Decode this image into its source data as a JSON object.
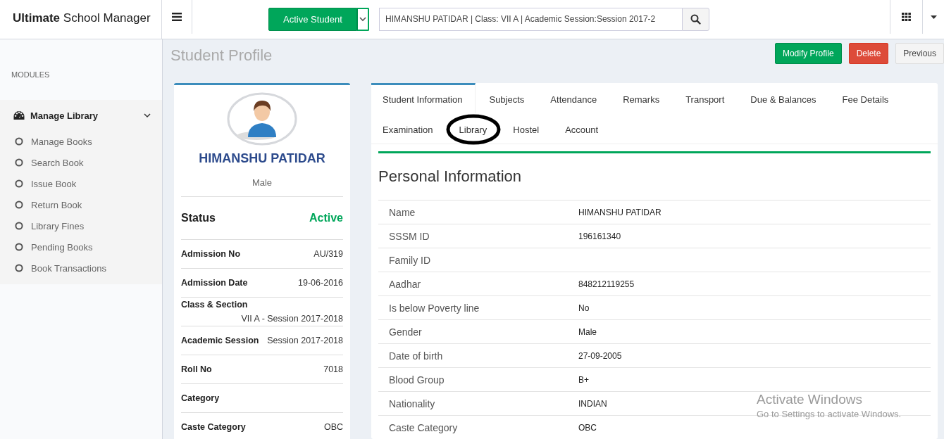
{
  "header": {
    "brand": "**Ultimate** School Manager",
    "filter_button": "Active Student",
    "search": {
      "value": "HIMANSHU PATIDAR | Class: VII A | Academic Session:Session 2017-2"
    }
  },
  "sidebar": {
    "section_label": "MODULES",
    "groups": [
      {
        "label": "Manage Library",
        "expanded": true,
        "children": [
          {
            "label": "Manage Books"
          },
          {
            "label": "Search Book"
          },
          {
            "label": "Issue Book"
          },
          {
            "label": "Return Book"
          },
          {
            "label": "Library Fines"
          },
          {
            "label": "Pending Books"
          },
          {
            "label": "Book Transactions"
          }
        ]
      }
    ]
  },
  "page_title": "Student Profile",
  "actions": [
    {
      "label": "Modify Profile",
      "kind": "success"
    },
    {
      "label": "Delete",
      "kind": "danger"
    },
    {
      "label": "Previous",
      "kind": "default"
    }
  ],
  "profile": {
    "name": "HIMANSHU PATIDAR",
    "gender": "Male",
    "status_label": "Status",
    "status_value": "Active",
    "fields": [
      {
        "label": "Admission No",
        "value": "AU/319"
      },
      {
        "label": "Admission Date",
        "value": "19-06-2016"
      },
      {
        "label": "Class & Section",
        "value": "VII A - Session 2017-2018"
      },
      {
        "label": "Academic Session",
        "value": "Session 2017-2018"
      },
      {
        "label": "Roll No",
        "value": "7018"
      },
      {
        "label": "Category"
      },
      {
        "label": "Caste Category",
        "value": "OBC"
      }
    ]
  },
  "tabs": [
    {
      "label": "Student Information",
      "selected": true,
      "circled": false
    },
    {
      "label": "Subjects",
      "selected": false,
      "circled": false
    },
    {
      "label": "Attendance",
      "selected": false,
      "circled": false
    },
    {
      "label": "Remarks",
      "selected": false,
      "circled": false
    },
    {
      "label": "Transport",
      "selected": false,
      "circled": false
    },
    {
      "label": "Due & Balances",
      "selected": false,
      "circled": false
    },
    {
      "label": "Fee Details",
      "selected": false,
      "circled": false
    },
    {
      "label": "Examination",
      "selected": false,
      "circled": false
    },
    {
      "label": "Library",
      "selected": false,
      "circled": true
    },
    {
      "label": "Hostel",
      "selected": false,
      "circled": false
    },
    {
      "label": "Account",
      "selected": false,
      "circled": false
    }
  ],
  "personal_info": {
    "title": "Personal Information",
    "rows": [
      {
        "label": "Name",
        "value": "HIMANSHU PATIDAR"
      },
      {
        "label": "SSSM ID",
        "value": "196161340"
      },
      {
        "label": "Family ID"
      },
      {
        "label": "Aadhar",
        "value": "848212119255"
      },
      {
        "label": "Is below Poverty line",
        "value": "No"
      },
      {
        "label": "Gender",
        "value": "Male"
      },
      {
        "label": "Date of birth",
        "value": "27-09-2005"
      },
      {
        "label": "Blood Group",
        "value": "B+"
      },
      {
        "label": "Nationality",
        "value": "INDIAN"
      },
      {
        "label": "Caste Category",
        "value": "OBC"
      }
    ]
  },
  "os_watermark": {
    "title": "Activate Windows",
    "subtitle": "Go to Settings to activate Windows."
  }
}
